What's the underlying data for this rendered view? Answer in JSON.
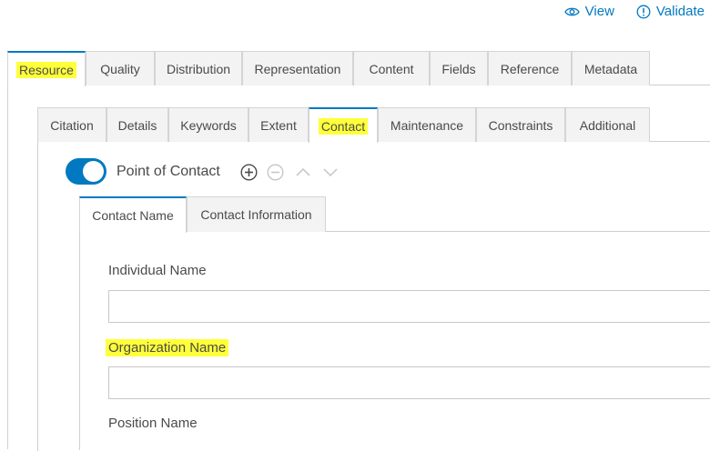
{
  "header": {
    "view_label": "View",
    "validate_label": "Validate",
    "view_icon": "eye-icon",
    "validate_icon": "info-circle-icon",
    "accent_color": "#0079c1"
  },
  "main_tabs": [
    {
      "label": "Resource",
      "active": true,
      "highlighted": true
    },
    {
      "label": "Quality"
    },
    {
      "label": "Distribution"
    },
    {
      "label": "Representation"
    },
    {
      "label": "Content"
    },
    {
      "label": "Fields"
    },
    {
      "label": "Reference"
    },
    {
      "label": "Metadata"
    }
  ],
  "resource_tabs": [
    {
      "label": "Citation"
    },
    {
      "label": "Details"
    },
    {
      "label": "Keywords"
    },
    {
      "label": "Extent"
    },
    {
      "label": "Contact",
      "active": true,
      "highlighted": true
    },
    {
      "label": "Maintenance"
    },
    {
      "label": "Constraints"
    },
    {
      "label": "Additional"
    }
  ],
  "point_of_contact": {
    "label": "Point of Contact",
    "enabled": true,
    "controls": [
      "add-circle-icon",
      "remove-circle-icon",
      "chevron-up-icon",
      "chevron-down-icon"
    ]
  },
  "contact_tabs": [
    {
      "label": "Contact Name",
      "active": true
    },
    {
      "label": "Contact Information"
    }
  ],
  "fields": {
    "individual_name": {
      "label": "Individual Name",
      "value": ""
    },
    "organization_name": {
      "label": "Organization Name",
      "value": "",
      "highlighted": true
    },
    "position_name": {
      "label": "Position Name"
    }
  },
  "highlight_color": "#ffff3a"
}
